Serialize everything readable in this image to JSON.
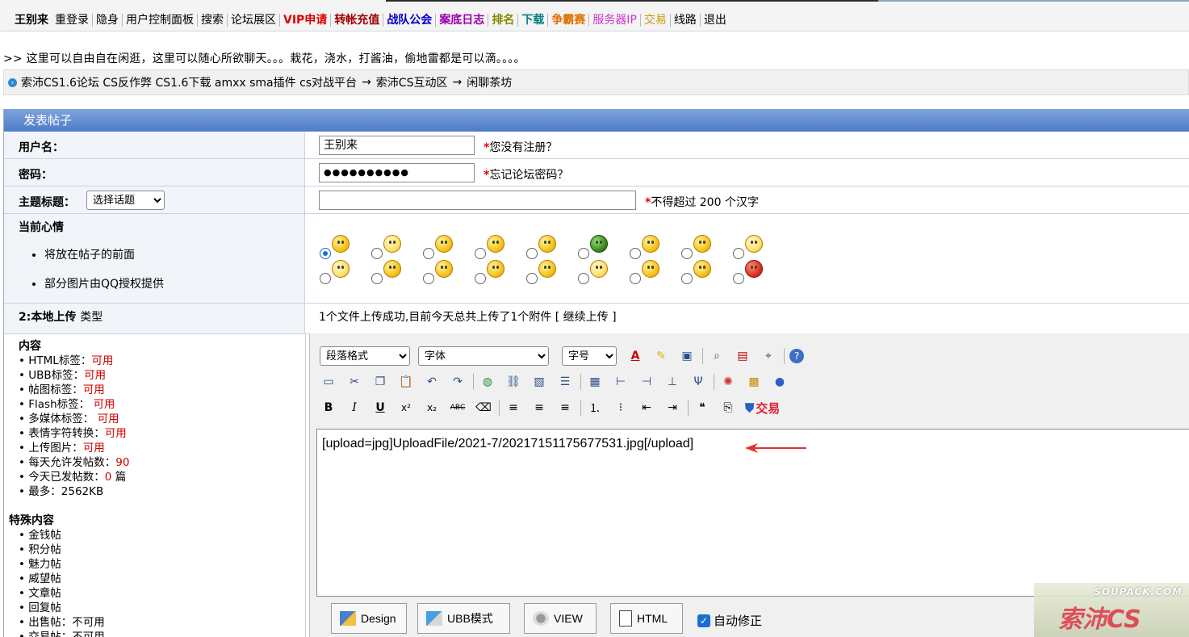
{
  "nav": {
    "items": [
      {
        "label": "王别来",
        "color": "#000000",
        "bold": true
      },
      {
        "label": "重登录",
        "color": "#000000",
        "bold": false
      },
      {
        "label": "隐身",
        "color": "#000000",
        "bold": false
      },
      {
        "label": "用户控制面板",
        "color": "#000000",
        "bold": false
      },
      {
        "label": "搜索",
        "color": "#000000",
        "bold": false
      },
      {
        "label": "论坛展区",
        "color": "#000000",
        "bold": false
      },
      {
        "label": "VIP申请",
        "color": "#e00000",
        "bold": true
      },
      {
        "label": "转帐充值",
        "color": "#a00000",
        "bold": true
      },
      {
        "label": "战队公会",
        "color": "#0000cc",
        "bold": true
      },
      {
        "label": "案底日志",
        "color": "#9900aa",
        "bold": true
      },
      {
        "label": "排名",
        "color": "#888800",
        "bold": true
      },
      {
        "label": "下载",
        "color": "#008080",
        "bold": true
      },
      {
        "label": "争霸赛",
        "color": "#e07000",
        "bold": true
      },
      {
        "label": "服务器IP",
        "color": "#cc33cc",
        "bold": false
      },
      {
        "label": "交易",
        "color": "#cc9900",
        "bold": false
      },
      {
        "label": "线路",
        "color": "#000000",
        "bold": false
      },
      {
        "label": "退出",
        "color": "#000000",
        "bold": false
      }
    ]
  },
  "welcome": ">> 这里可以自由自在闲逛，这里可以随心所欲聊天。。。栽花，浇水，打酱油，偷地雷都是可以滴。。。。",
  "breadcrumb": {
    "site": "索沛CS1.6论坛 CS反作弊 CS1.6下载 amxx sma插件 cs对战平台",
    "arrow": "→",
    "section": "索沛CS互动区",
    "board": "闲聊茶坊"
  },
  "form": {
    "header": "发表帖子",
    "username_label": "用户名：",
    "username_value": "王别来",
    "username_hint": "您没有注册？",
    "password_label": "密码：",
    "password_value": "●●●●●●●●●●",
    "password_hint": "忘记论坛密码？",
    "subject_label": "主题标题：",
    "subject_select": "选择话题",
    "subject_hint": "不得超过 200 个汉字",
    "required_mark": "*",
    "mood_label": "当前心情",
    "mood_notes": [
      "将放在帖子的前面",
      "部分图片由QQ授权提供"
    ],
    "upload_label": "2:本地上传",
    "upload_type": "类型",
    "upload_status": "1个文件上传成功,目前今天总共上传了1个附件 [ 继续上传 ]"
  },
  "sidebar": {
    "content_title": "内容",
    "content_items": [
      {
        "label": "HTML标签：",
        "value": "可用"
      },
      {
        "label": "UBB标签：",
        "value": "可用"
      },
      {
        "label": "帖图标签：",
        "value": "可用"
      },
      {
        "label": "Flash标签： ",
        "value": "可用"
      },
      {
        "label": "多媒体标签： ",
        "value": "可用"
      },
      {
        "label": "表情字符转换：",
        "value": "可用"
      },
      {
        "label": "上传图片：",
        "value": "可用"
      },
      {
        "label": "每天允许发帖数：",
        "value": "90"
      },
      {
        "label": "今天已发帖数：",
        "value": "0",
        "suffix": " 篇"
      },
      {
        "label": "最多：2562KB",
        "value": ""
      }
    ],
    "special_title": "特殊内容",
    "special_items": [
      "金钱帖",
      "积分帖",
      "魅力帖",
      "威望帖",
      "文章帖",
      "回复帖",
      "出售帖：不可用",
      "交易帖：不可用"
    ]
  },
  "editor": {
    "format_select": "段落格式",
    "font_select": "字体",
    "size_select": "字号",
    "trade_label": "交易",
    "content": "[upload=jpg]UploadFile/2021-7/20217151175677531.jpg[/upload]",
    "modes": [
      "Design",
      "UBB模式",
      "VIEW",
      "HTML"
    ],
    "autofix_label": "自动修正"
  },
  "watermark": {
    "line1": "SOUPACK.COM",
    "line2": "索沛CS"
  }
}
